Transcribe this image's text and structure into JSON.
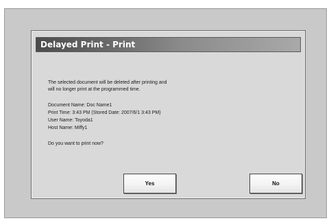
{
  "dialog": {
    "title": "Delayed Print - Print",
    "message_line1": "The selected document will be deleted after printing and",
    "message_line2": "will no longer print at the programmed time.",
    "document_name": "Document Name: Doc Name1",
    "print_time": "Print Time: 3:43 PM (Stored Date: 2007/6/1 3:43 PM)",
    "user_name": "User Name: Toyoda1",
    "host_name": "Host Name: Miffy1",
    "question": "Do you want to print now?",
    "yes_label": "Yes",
    "no_label": "No"
  },
  "colors": {
    "screen_background": "#c9c9c9",
    "dialog_background": "#d9d9d9",
    "title_gradient_start": "#4c4c4c",
    "title_gradient_end": "#a9a9a9"
  }
}
